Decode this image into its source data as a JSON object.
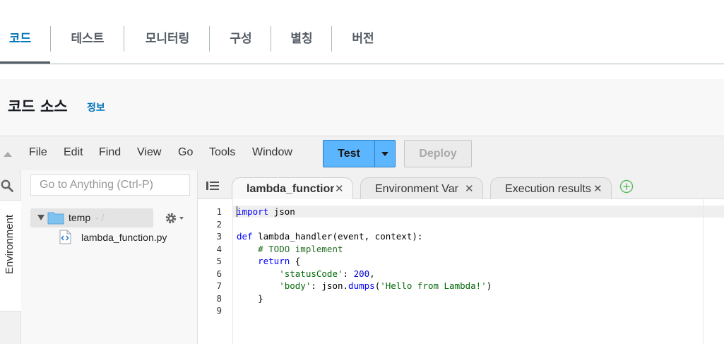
{
  "top_tabs": [
    {
      "label": "코드",
      "active": true
    },
    {
      "label": "테스트",
      "active": false
    },
    {
      "label": "모니터링",
      "active": false
    },
    {
      "label": "구성",
      "active": false
    },
    {
      "label": "별칭",
      "active": false
    },
    {
      "label": "버전",
      "active": false
    }
  ],
  "section": {
    "title": "코드 소스",
    "info_link": "정보"
  },
  "menubar": {
    "items": [
      "File",
      "Edit",
      "Find",
      "View",
      "Go",
      "Tools",
      "Window"
    ],
    "test_label": "Test",
    "deploy_label": "Deploy"
  },
  "sidebar": {
    "rail_tab": "Environment",
    "search_placeholder": "Go to Anything (Ctrl-P)",
    "folder": {
      "name": "temp",
      "path": "- /"
    },
    "files": [
      "lambda_function.py"
    ]
  },
  "editor_tabs": [
    {
      "label": "lambda_function",
      "active": true
    },
    {
      "label": "Environment Var",
      "active": false
    },
    {
      "label": "Execution results",
      "active": false
    }
  ],
  "editor": {
    "line_numbers": [
      "1",
      "2",
      "3",
      "4",
      "5",
      "6",
      "7",
      "8",
      "9"
    ],
    "code": {
      "l1_kw": "import",
      "l1_rest": " json",
      "l3_kw": "def",
      "l3_rest": " lambda_handler(event, context):",
      "l4_comment": "    # TODO implement",
      "l5_kw": "    return",
      "l5_rest": " {",
      "l6_key": "        'statusCode'",
      "l6_sep": ": ",
      "l6_val": "200",
      "l6_end": ",",
      "l7_key": "        'body'",
      "l7_mid": ": json.",
      "l7_fn": "dumps",
      "l7_open": "(",
      "l7_str": "'Hello from Lambda!'",
      "l7_close": ")",
      "l8": "    }"
    }
  },
  "colors": {
    "accent": "#0073bb",
    "test_button": "#5cb6ff"
  }
}
